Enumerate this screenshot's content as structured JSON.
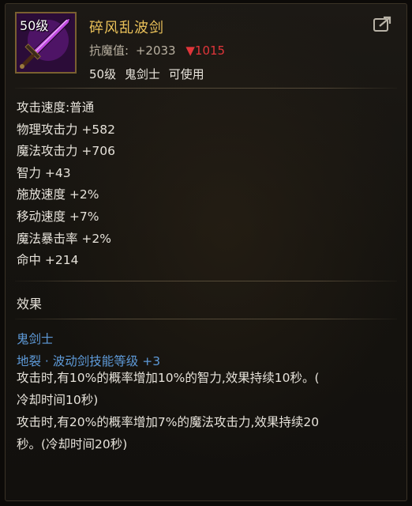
{
  "item": {
    "level_badge": "50级",
    "name": "碎风乱波剑",
    "resist_label": "抗魔值:",
    "resist_value": "+2033",
    "resist_diff": "▼1015",
    "requirement": {
      "level": "50级",
      "class": "鬼剑士",
      "usable": "可使用"
    },
    "icon": "purple-sword-icon"
  },
  "header_actions": {
    "share_icon": "share-export-icon"
  },
  "stats": [
    "攻击速度:普通",
    "物理攻击力 +582",
    "魔法攻击力 +706",
    "智力 +43",
    "施放速度 +2%",
    "移动速度 +7%",
    "魔法暴击率 +2%",
    "命中 +214"
  ],
  "effects": {
    "title": "效果",
    "class_name": "鬼剑士",
    "skill_bonus": "地裂 · 波动剑技能等级 +3",
    "lines": [
      "攻击时,有10%的概率增加10%的智力,效果持续10秒。(",
      "冷却时间10秒)",
      "攻击时,有20%的概率增加7%的魔法攻击力,效果持续20",
      "秒。(冷却时间20秒)"
    ]
  },
  "colors": {
    "item_name": "#e9c059",
    "resist_down": "#e0353a",
    "effect_blue": "#5e9ad8",
    "text": "#e6e2da",
    "icon_frame": "#7a6030"
  }
}
